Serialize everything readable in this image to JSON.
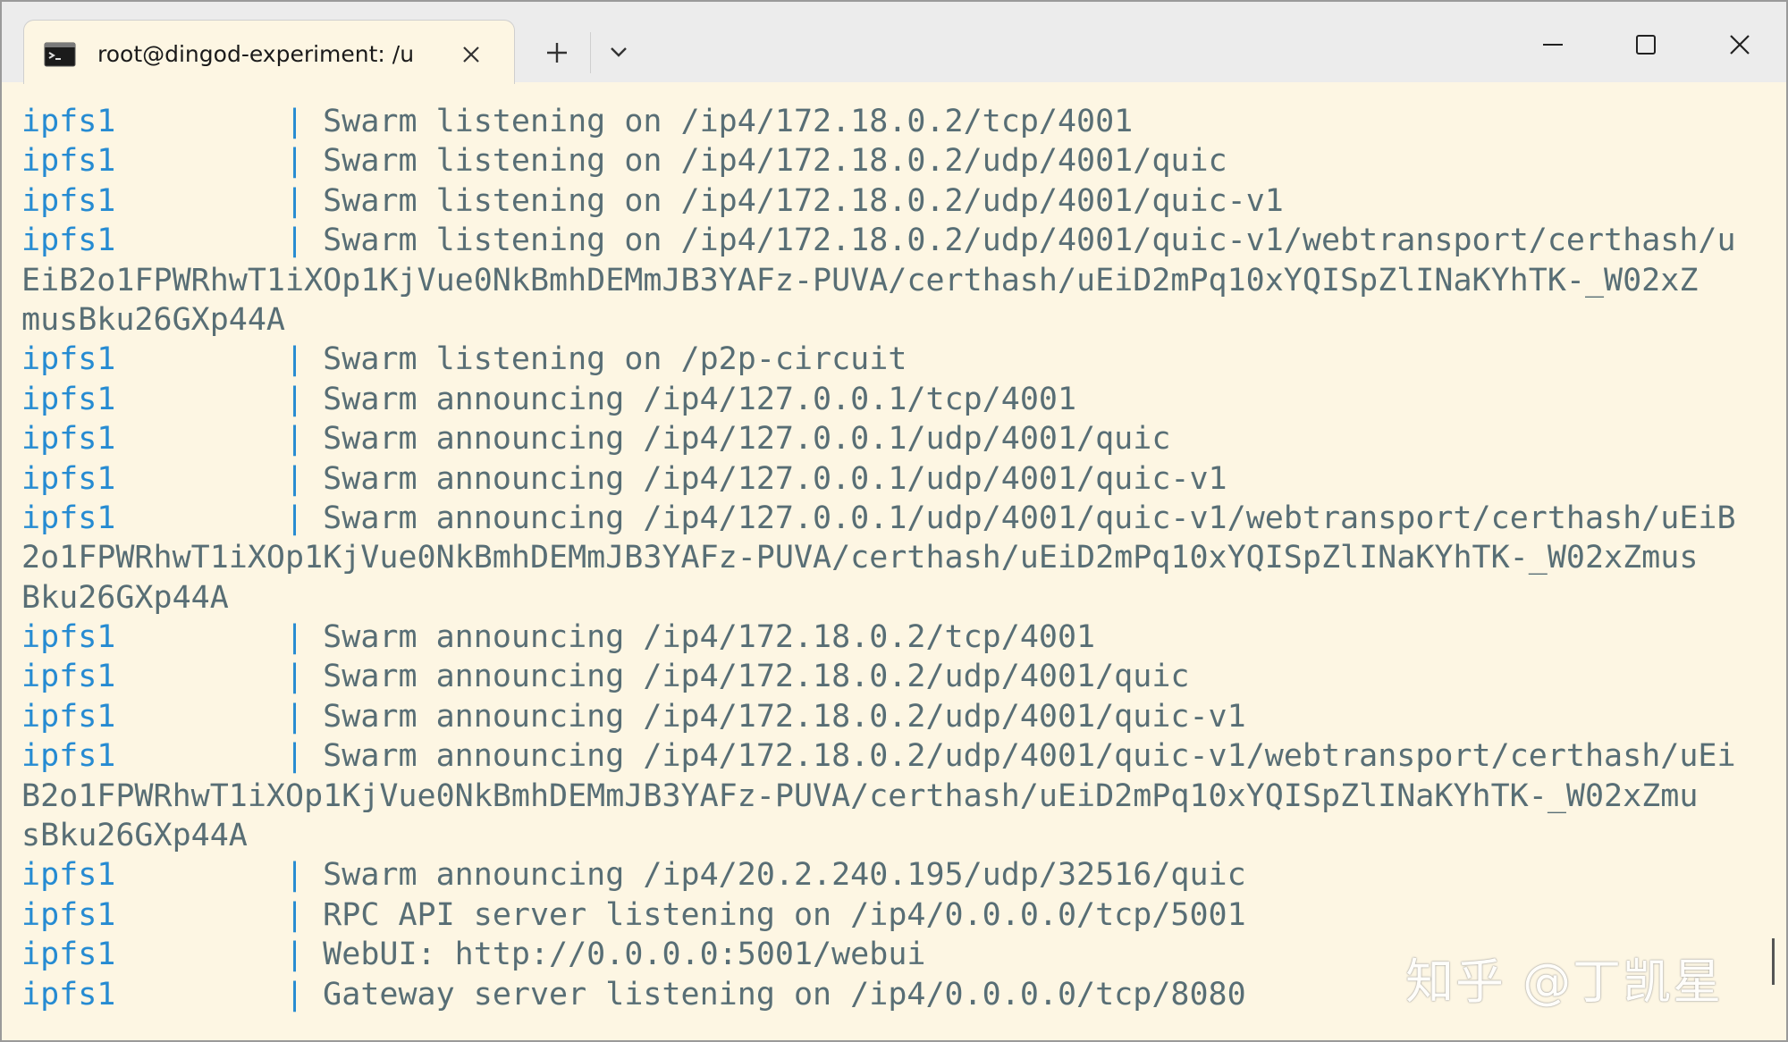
{
  "window": {
    "tab_title": "root@dingod-experiment: /u",
    "new_tab_symbol": "+",
    "controls": [
      "minimize-icon",
      "maximize-icon",
      "close-icon"
    ]
  },
  "colors": {
    "background": "#fdf6e3",
    "service": "#268bd2",
    "text": "#586e75"
  },
  "terminal": {
    "lines": [
      {
        "service": "ipfs1",
        "sep": "|",
        "text": "Swarm listening on /ip4/172.18.0.2/tcp/4001"
      },
      {
        "service": "ipfs1",
        "sep": "|",
        "text": "Swarm listening on /ip4/172.18.0.2/udp/4001/quic"
      },
      {
        "service": "ipfs1",
        "sep": "|",
        "text": "Swarm listening on /ip4/172.18.0.2/udp/4001/quic-v1"
      },
      {
        "service": "ipfs1",
        "sep": "|",
        "text": "Swarm listening on /ip4/172.18.0.2/udp/4001/quic-v1/webtransport/certhash/u"
      },
      {
        "service": "",
        "sep": "",
        "text": "EiB2o1FPWRhwT1iXOp1KjVue0NkBmhDEMmJB3YAFz-PUVA/certhash/uEiD2mPq10xYQISpZlINaKYhTK-_W02xZ"
      },
      {
        "service": "",
        "sep": "",
        "text": "musBku26GXp44A"
      },
      {
        "service": "ipfs1",
        "sep": "|",
        "text": "Swarm listening on /p2p-circuit"
      },
      {
        "service": "ipfs1",
        "sep": "|",
        "text": "Swarm announcing /ip4/127.0.0.1/tcp/4001"
      },
      {
        "service": "ipfs1",
        "sep": "|",
        "text": "Swarm announcing /ip4/127.0.0.1/udp/4001/quic"
      },
      {
        "service": "ipfs1",
        "sep": "|",
        "text": "Swarm announcing /ip4/127.0.0.1/udp/4001/quic-v1"
      },
      {
        "service": "ipfs1",
        "sep": "|",
        "text": "Swarm announcing /ip4/127.0.0.1/udp/4001/quic-v1/webtransport/certhash/uEiB"
      },
      {
        "service": "",
        "sep": "",
        "text": "2o1FPWRhwT1iXOp1KjVue0NkBmhDEMmJB3YAFz-PUVA/certhash/uEiD2mPq10xYQISpZlINaKYhTK-_W02xZmus"
      },
      {
        "service": "",
        "sep": "",
        "text": "Bku26GXp44A"
      },
      {
        "service": "ipfs1",
        "sep": "|",
        "text": "Swarm announcing /ip4/172.18.0.2/tcp/4001"
      },
      {
        "service": "ipfs1",
        "sep": "|",
        "text": "Swarm announcing /ip4/172.18.0.2/udp/4001/quic"
      },
      {
        "service": "ipfs1",
        "sep": "|",
        "text": "Swarm announcing /ip4/172.18.0.2/udp/4001/quic-v1"
      },
      {
        "service": "ipfs1",
        "sep": "|",
        "text": "Swarm announcing /ip4/172.18.0.2/udp/4001/quic-v1/webtransport/certhash/uEi"
      },
      {
        "service": "",
        "sep": "",
        "text": "B2o1FPWRhwT1iXOp1KjVue0NkBmhDEMmJB3YAFz-PUVA/certhash/uEiD2mPq10xYQISpZlINaKYhTK-_W02xZmu"
      },
      {
        "service": "",
        "sep": "",
        "text": "sBku26GXp44A"
      },
      {
        "service": "ipfs1",
        "sep": "|",
        "text": "Swarm announcing /ip4/20.2.240.195/udp/32516/quic"
      },
      {
        "service": "ipfs1",
        "sep": "|",
        "text": "RPC API server listening on /ip4/0.0.0.0/tcp/5001"
      },
      {
        "service": "ipfs1",
        "sep": "|",
        "text": "WebUI: http://0.0.0.0:5001/webui"
      },
      {
        "service": "ipfs1",
        "sep": "|",
        "text": "Gateway server listening on /ip4/0.0.0.0/tcp/8080"
      }
    ]
  },
  "watermark": {
    "text": "知乎 @丁凯星"
  }
}
